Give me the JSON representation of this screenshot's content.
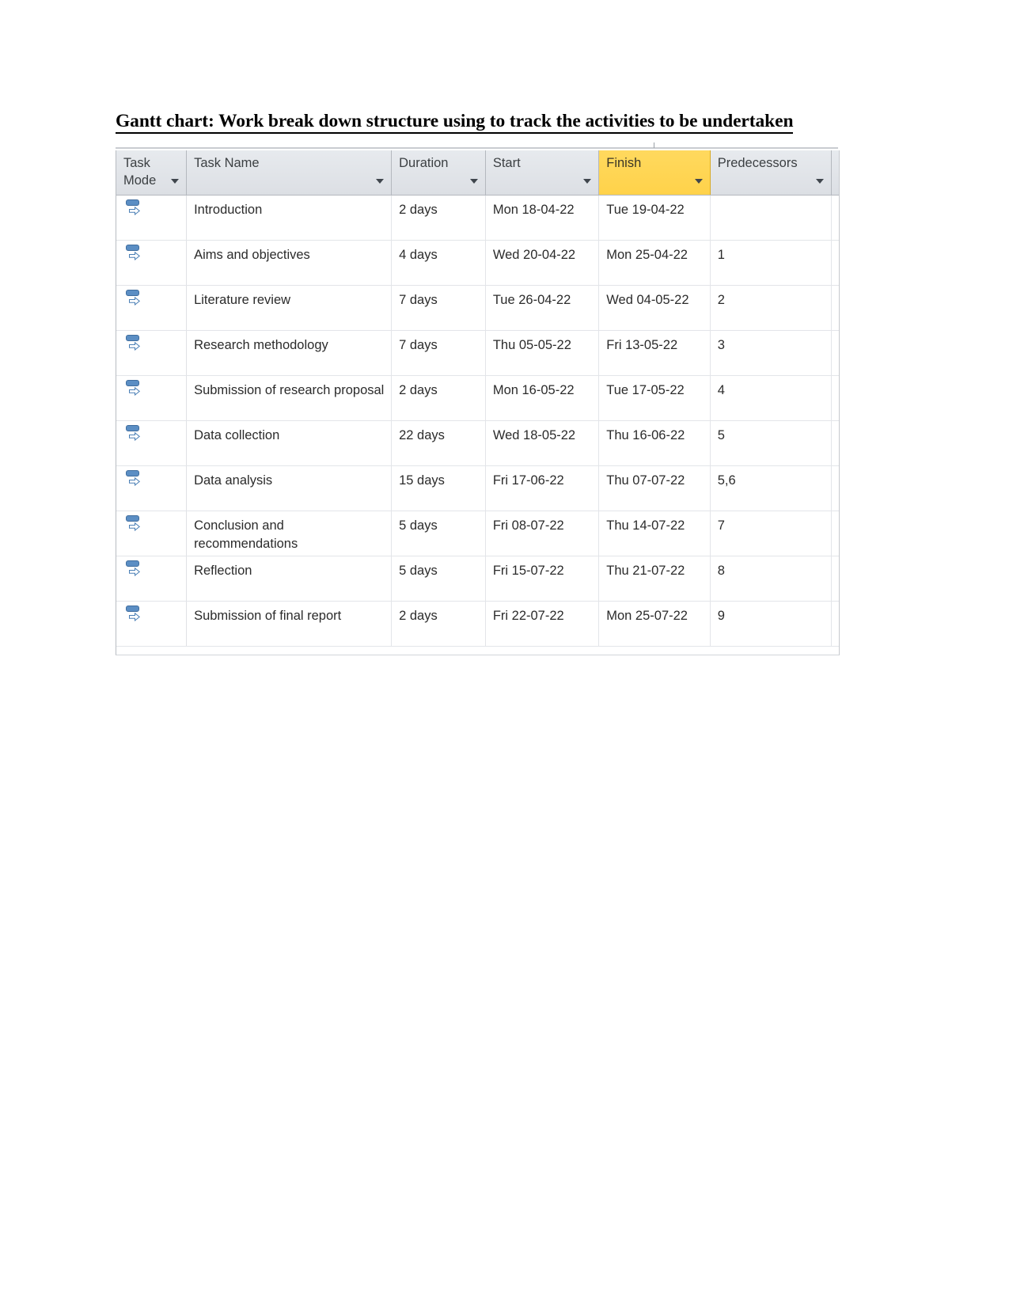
{
  "document": {
    "title": "Gantt chart: Work break down structure using to track the activities to be undertaken"
  },
  "grid": {
    "columns": [
      {
        "key": "mode",
        "label": "Task Mode",
        "filter_icon": "chevron-down-icon",
        "selected": false
      },
      {
        "key": "name",
        "label": "Task Name",
        "filter_icon": "chevron-down-icon",
        "selected": false
      },
      {
        "key": "dur",
        "label": "Duration",
        "filter_icon": "chevron-down-icon",
        "selected": false
      },
      {
        "key": "start",
        "label": "Start",
        "filter_icon": "chevron-down-icon",
        "selected": false
      },
      {
        "key": "fin",
        "label": "Finish",
        "filter_icon": "chevron-down-icon",
        "selected": true
      },
      {
        "key": "pred",
        "label": "Predecessors",
        "filter_icon": "chevron-down-icon",
        "selected": false
      }
    ],
    "selected_column_color": "#FFD24A",
    "header_background": "#DFE2E7",
    "task_mode_icon": "auto-scheduled-icon",
    "rows": [
      {
        "mode": "",
        "name": "Introduction",
        "dur": "2 days",
        "start": "Mon 18-04-22",
        "fin": "Tue 19-04-22",
        "pred": ""
      },
      {
        "mode": "",
        "name": "Aims and objectives",
        "dur": "4 days",
        "start": "Wed 20-04-22",
        "fin": "Mon 25-04-22",
        "pred": "1"
      },
      {
        "mode": "",
        "name": "Literature review",
        "dur": "7 days",
        "start": "Tue 26-04-22",
        "fin": "Wed 04-05-22",
        "pred": "2"
      },
      {
        "mode": "",
        "name": "Research methodology",
        "dur": "7 days",
        "start": "Thu 05-05-22",
        "fin": "Fri 13-05-22",
        "pred": "3"
      },
      {
        "mode": "",
        "name": "Submission of research proposal",
        "dur": "2 days",
        "start": "Mon 16-05-22",
        "fin": "Tue 17-05-22",
        "pred": "4"
      },
      {
        "mode": "",
        "name": "Data collection",
        "dur": "22 days",
        "start": "Wed 18-05-22",
        "fin": "Thu 16-06-22",
        "pred": "5"
      },
      {
        "mode": "",
        "name": "Data analysis",
        "dur": "15 days",
        "start": "Fri 17-06-22",
        "fin": "Thu 07-07-22",
        "pred": "5,6"
      },
      {
        "mode": "",
        "name": "Conclusion and recommendations",
        "dur": "5 days",
        "start": "Fri 08-07-22",
        "fin": "Thu 14-07-22",
        "pred": "7"
      },
      {
        "mode": "",
        "name": "Reflection",
        "dur": "5 days",
        "start": "Fri 15-07-22",
        "fin": "Thu 21-07-22",
        "pred": "8"
      },
      {
        "mode": "",
        "name": "Submission of final report",
        "dur": "2 days",
        "start": "Fri 22-07-22",
        "fin": "Mon 25-07-22",
        "pred": "9"
      }
    ]
  }
}
